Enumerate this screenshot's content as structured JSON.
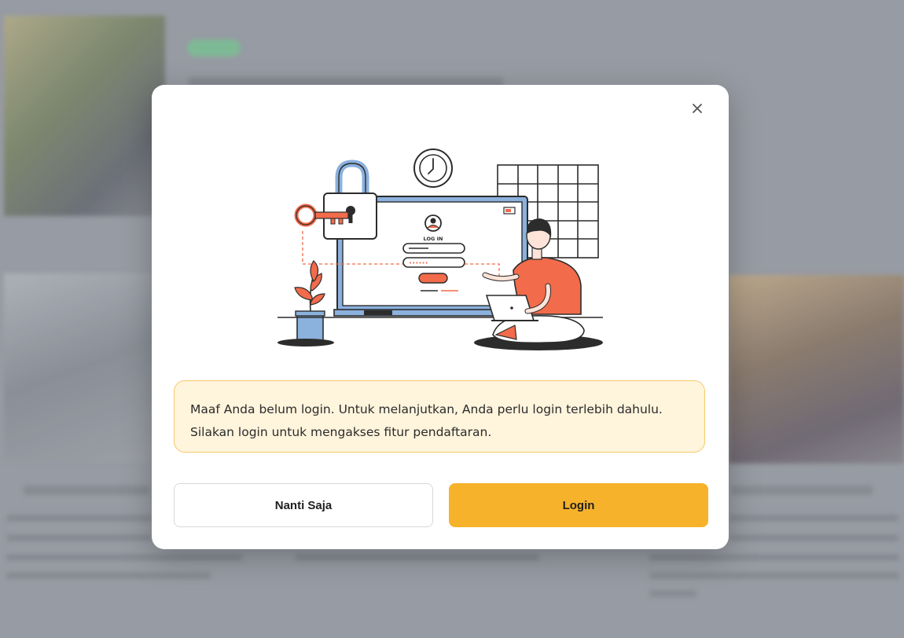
{
  "dialog": {
    "message": "Maaf Anda belum login. Untuk melanjutkan, Anda perlu login terlebih dahulu. Silakan login untuk mengakses fitur pendaftaran.",
    "close_icon": "close-icon",
    "illustration_caption": "LOG IN",
    "illustration_password_mask": "••••••",
    "buttons": {
      "later_label": "Nanti Saja",
      "login_label": "Login"
    }
  },
  "colors": {
    "accent": "#f7b22b",
    "notice_bg": "#fff4dc",
    "notice_border": "#f5c96a",
    "illustration_orange": "#f26b4b",
    "illustration_blue": "#8bb1dd"
  }
}
